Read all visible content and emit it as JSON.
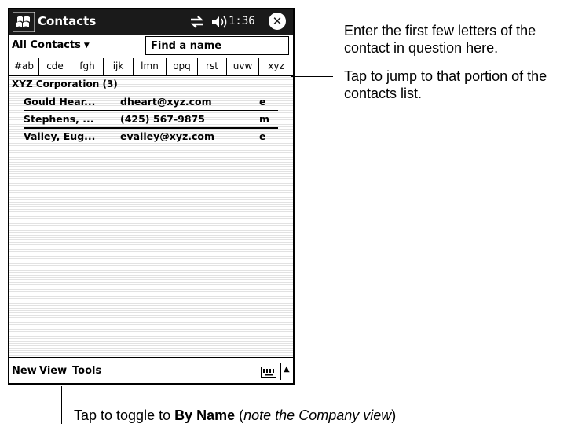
{
  "titlebar": {
    "app_title": "Contacts",
    "time": "1:36",
    "start_icon": "windows-flag-icon",
    "connectivity_icon": "connectivity-arrows-icon",
    "volume_icon": "speaker-icon",
    "close_icon": "close-circle-icon",
    "close_glyph": "✕"
  },
  "toolbar": {
    "category_label": "All Contacts",
    "category_caret": "▼",
    "find_placeholder": "Find a name"
  },
  "alpha_tabs": [
    "#ab",
    "cde",
    "fgh",
    "ijk",
    "lmn",
    "opq",
    "rst",
    "uvw",
    "xyz"
  ],
  "group": {
    "header": "XYZ Corporation (3)"
  },
  "contacts": [
    {
      "name": "Gould Hear...",
      "info": "dheart@xyz.com",
      "type": "e"
    },
    {
      "name": "Stephens, ...",
      "info": "(425) 567-9875",
      "type": "m"
    },
    {
      "name": "Valley, Eug...",
      "info": "evalley@xyz.com",
      "type": "e"
    }
  ],
  "menubar": {
    "new_label": "New",
    "view_label": "View",
    "tools_label": "Tools",
    "keyboard_icon": "keyboard-icon",
    "sip_arrow": "▲"
  },
  "annotations": {
    "find": "Enter the first few letters of the contact in question here.",
    "tabs": "Tap to jump to that portion of the contacts list.",
    "view_prefix": "Tap to toggle to ",
    "view_bold": "By Name",
    "view_paren_open": " (",
    "view_italic": "note the Company view",
    "view_paren_close": ")"
  }
}
